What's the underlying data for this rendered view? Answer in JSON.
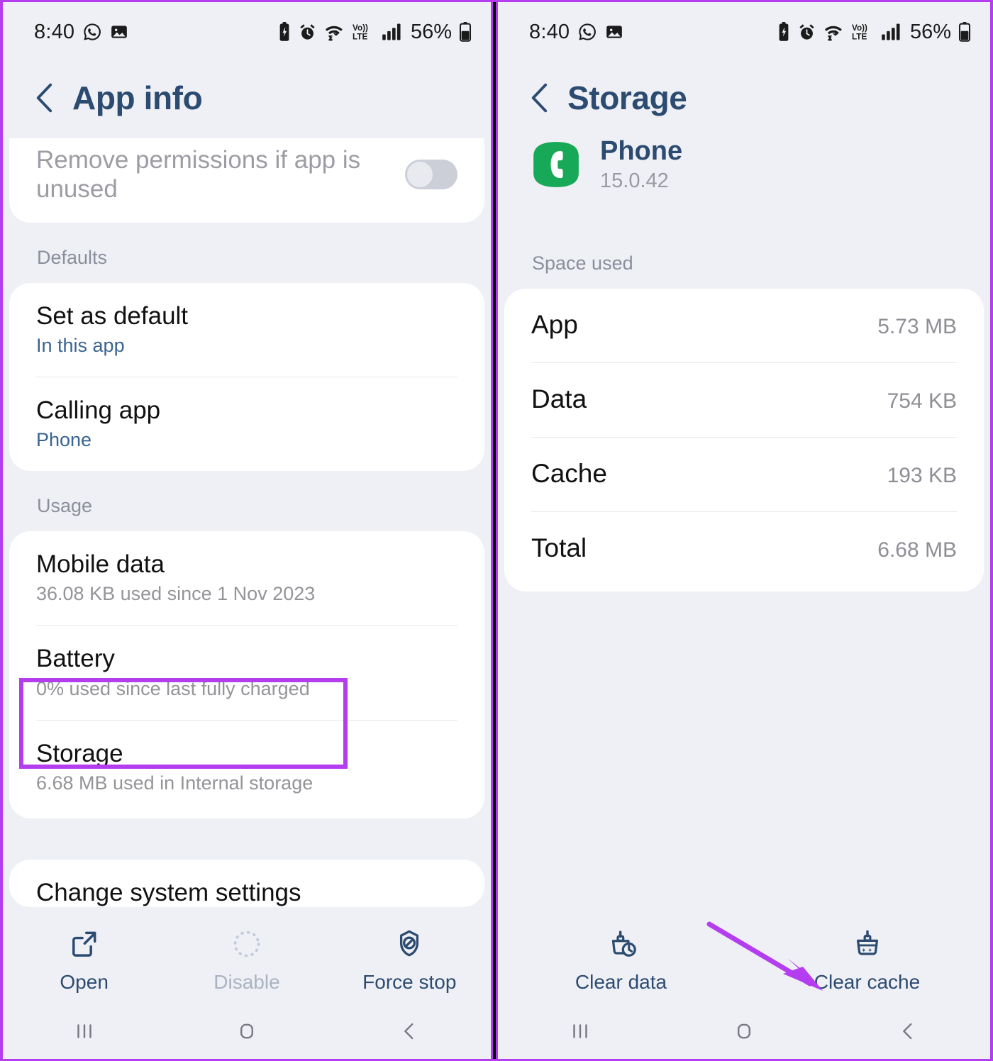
{
  "accent": {
    "highlight_purple": "#b53df0",
    "header_blue": "#2c4b70",
    "link_blue": "#3a6491",
    "app_icon_green": "#17a957"
  },
  "status_bar": {
    "time": "8:40",
    "battery_percent": "56%",
    "left_icons": [
      "whatsapp-icon",
      "photo-icon"
    ],
    "right_icons": [
      "battery-saver-icon",
      "alarm-icon",
      "wifi-icon",
      "volte-icon",
      "signal-icon",
      "battery-icon"
    ]
  },
  "left_panel": {
    "header": {
      "title": "App info",
      "back": "back-chevron"
    },
    "rows": {
      "remove_permissions": {
        "title": "Remove permissions if app is unused",
        "toggle_state": "off"
      }
    },
    "sections": [
      {
        "label": "Defaults",
        "items": [
          {
            "title": "Set as default",
            "sub": "In this app",
            "sub_style": "link"
          },
          {
            "title": "Calling app",
            "sub": "Phone",
            "sub_style": "link"
          }
        ]
      },
      {
        "label": "Usage",
        "items": [
          {
            "title": "Mobile data",
            "sub": "36.08 KB used since 1 Nov 2023",
            "sub_style": "muted"
          },
          {
            "title": "Battery",
            "sub": "0% used since last fully charged",
            "sub_style": "muted"
          },
          {
            "title": "Storage",
            "sub": "6.68 MB used in Internal storage",
            "sub_style": "muted",
            "highlighted": true
          }
        ]
      }
    ],
    "partial_card": {
      "title": "Change system settings"
    },
    "actions": [
      {
        "label": "Open",
        "icon": "open-external-icon",
        "disabled": false
      },
      {
        "label": "Disable",
        "icon": "disable-dotted-circle-icon",
        "disabled": true
      },
      {
        "label": "Force stop",
        "icon": "force-stop-icon",
        "disabled": false
      }
    ]
  },
  "right_panel": {
    "header": {
      "title": "Storage",
      "back": "back-chevron"
    },
    "app": {
      "name": "Phone",
      "version": "15.0.42",
      "icon": "phone-app-icon"
    },
    "space_used": {
      "label": "Space used",
      "rows": [
        {
          "label": "App",
          "value": "5.73 MB"
        },
        {
          "label": "Data",
          "value": "754 KB"
        },
        {
          "label": "Cache",
          "value": "193 KB"
        },
        {
          "label": "Total",
          "value": "6.68 MB"
        }
      ]
    },
    "actions": [
      {
        "label": "Clear data",
        "icon": "clear-data-broom-icon"
      },
      {
        "label": "Clear cache",
        "icon": "clear-cache-broom-icon"
      }
    ]
  },
  "navbar": {
    "buttons": [
      {
        "name": "recents",
        "icon": "recents-icon"
      },
      {
        "name": "home",
        "icon": "home-icon"
      },
      {
        "name": "back",
        "icon": "back-icon"
      }
    ]
  }
}
